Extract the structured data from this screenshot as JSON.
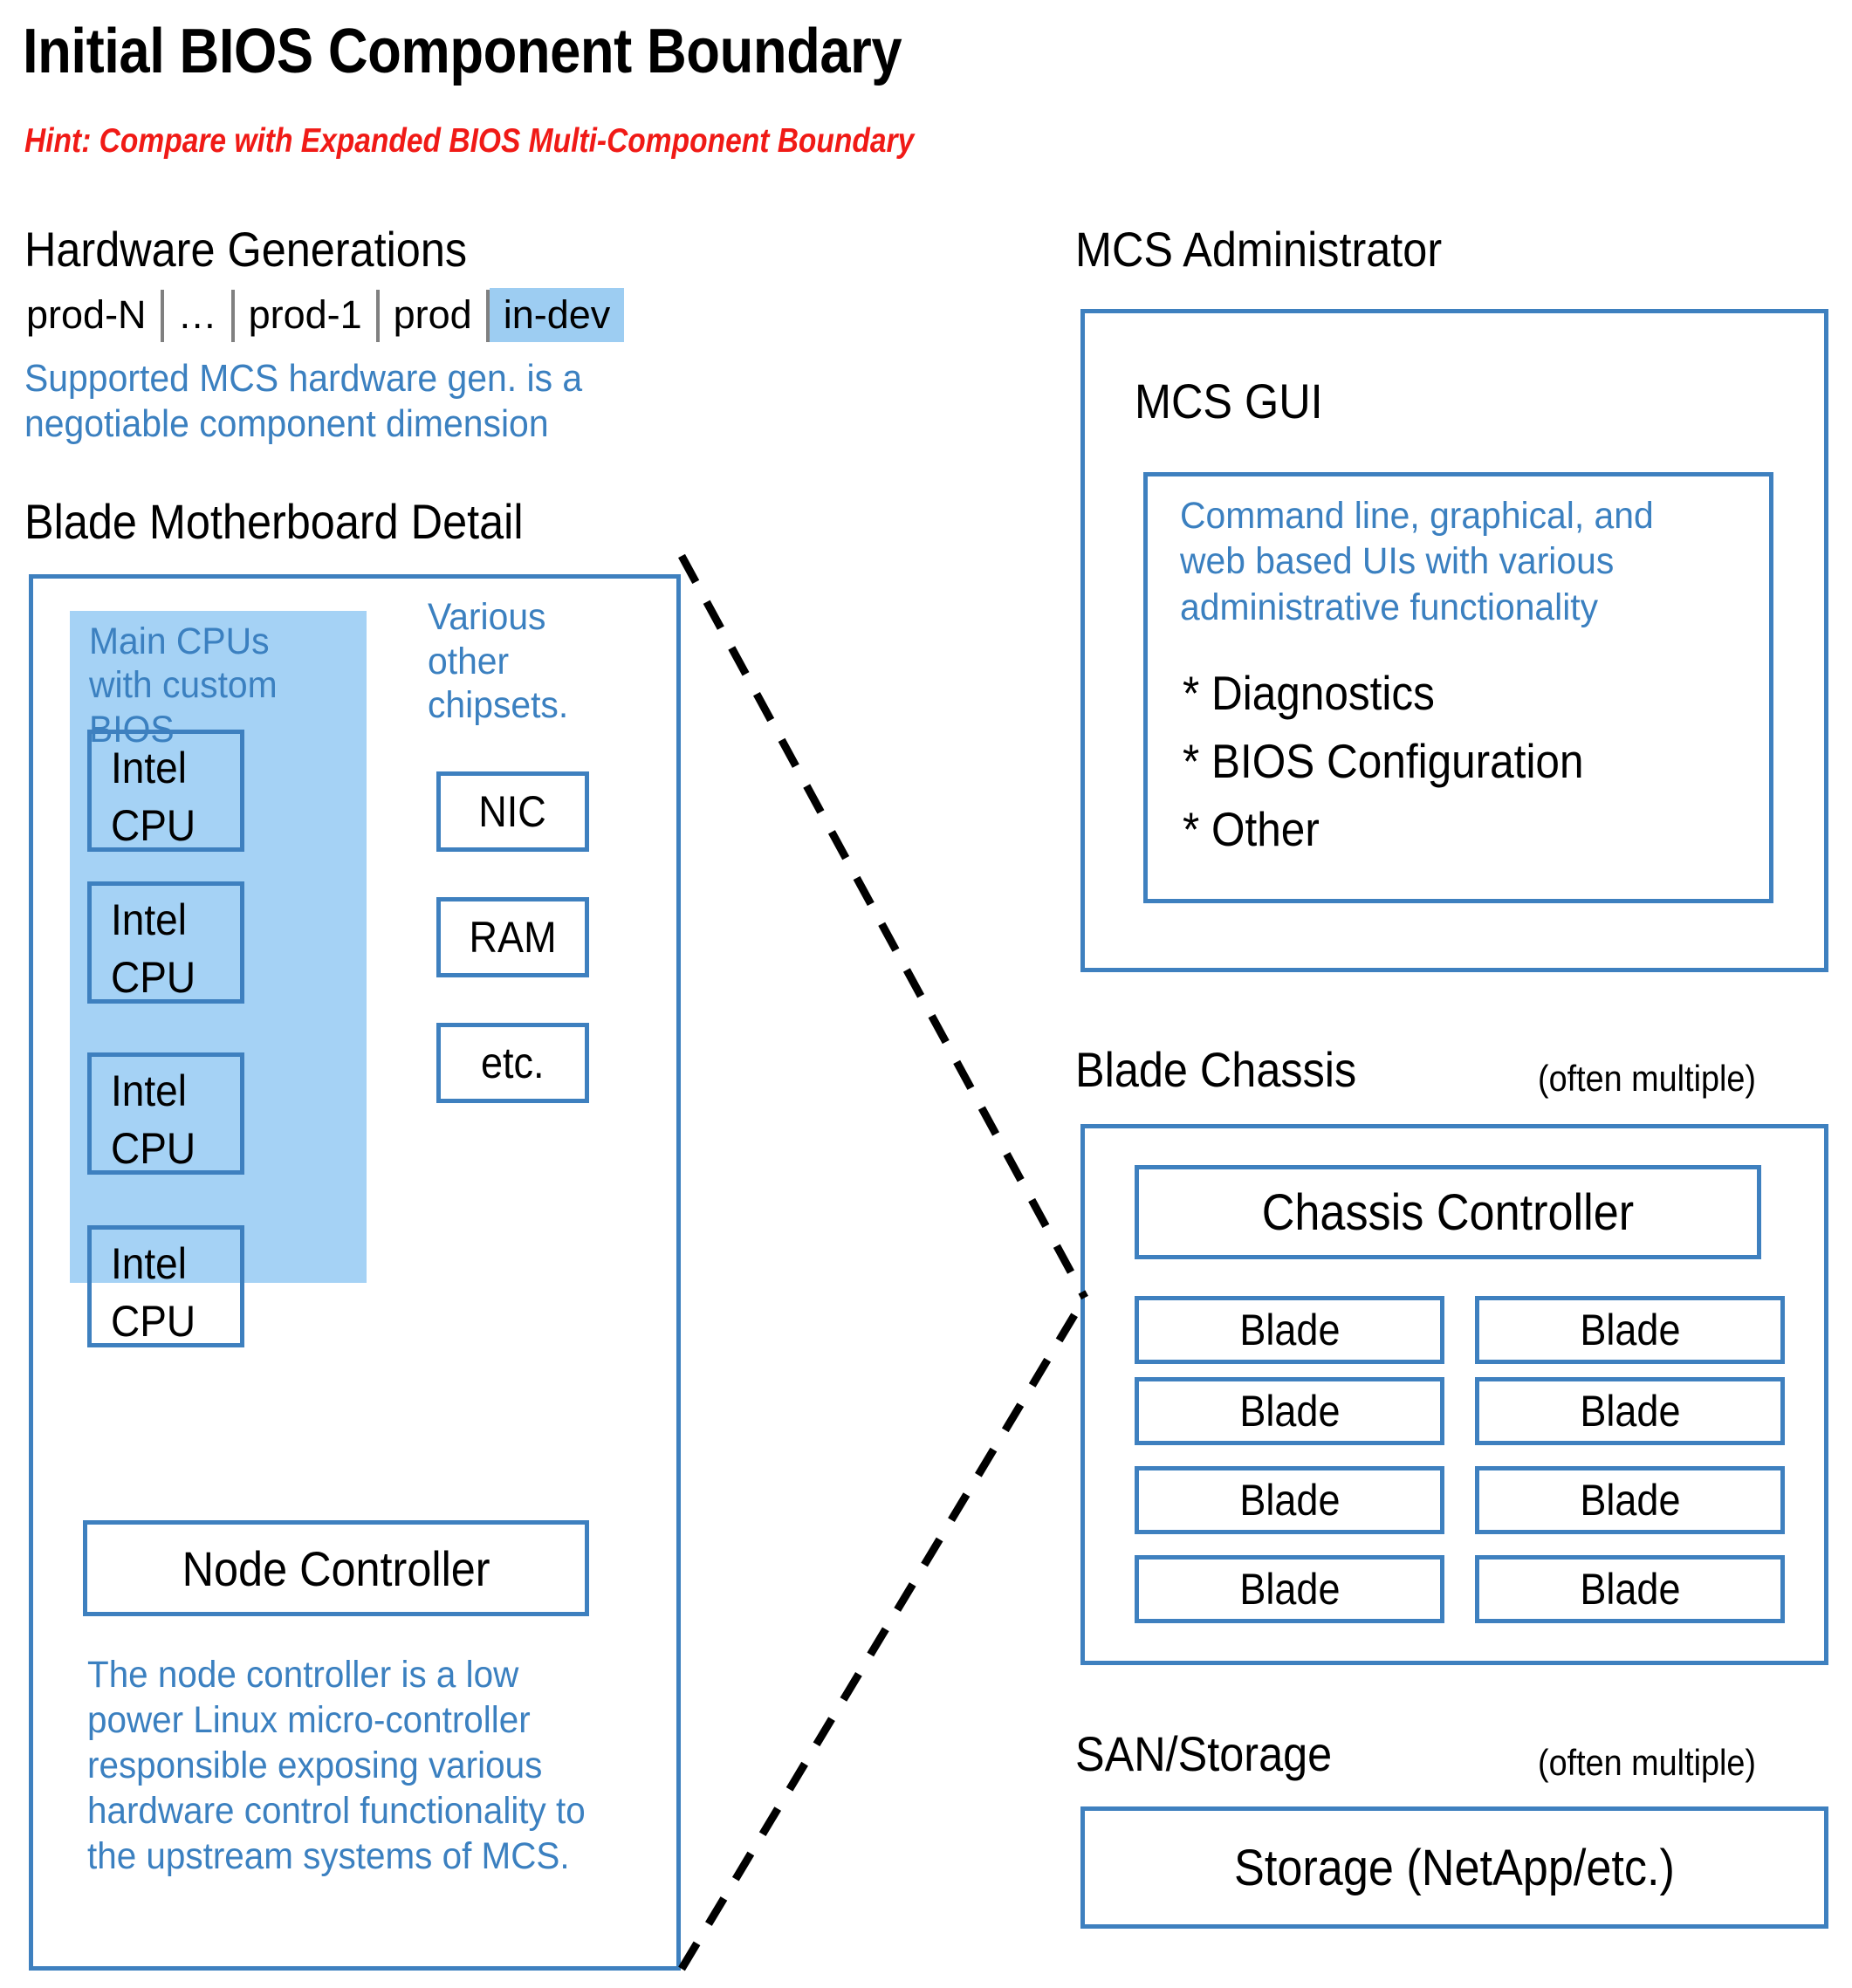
{
  "title": "Initial BIOS Component Boundary",
  "subtitle": "Hint: Compare with  Expanded BIOS Multi-Component Boundary",
  "colors": {
    "accent_blue": "#3E80BF",
    "text_blue": "#3B80C0",
    "panel_fill": "#A5D2F5",
    "highlight_fill": "#9DCDF2",
    "hint_red": "#F01A16",
    "separator_gray": "#808080"
  },
  "hardware_generations": {
    "heading": "Hardware Generations",
    "items": [
      {
        "label": "prod-N",
        "highlighted": false
      },
      {
        "label": "…",
        "highlighted": false
      },
      {
        "label": "prod-1",
        "highlighted": false
      },
      {
        "label": "prod",
        "highlighted": false
      },
      {
        "label": "in-dev",
        "highlighted": true
      }
    ],
    "note": "Supported MCS hardware gen. is a negotiable component dimension"
  },
  "blade_motherboard": {
    "heading": "Blade Motherboard Detail",
    "cpu_panel": {
      "label": "Main CPUs with custom BIOS",
      "cpus": [
        {
          "brand": "Intel",
          "kind": "CPU"
        },
        {
          "brand": "Intel",
          "kind": "CPU"
        },
        {
          "brand": "Intel",
          "kind": "CPU"
        },
        {
          "brand": "Intel",
          "kind": "CPU"
        }
      ]
    },
    "chipsets": {
      "label": "Various other chipsets.",
      "items": [
        "NIC",
        "RAM",
        "etc."
      ]
    },
    "node_controller": {
      "label": "Node Controller",
      "note": "The node controller is a low power Linux  micro-controller responsible exposing various hardware control functionality to the upstream systems of MCS."
    }
  },
  "mcs_administrator": {
    "heading": "MCS Administrator",
    "gui": {
      "heading": "MCS GUI",
      "note": "Command line, graphical, and web based UIs with various administrative functionality",
      "bullets": [
        "* Diagnostics",
        "* BIOS Configuration",
        "* Other"
      ]
    }
  },
  "blade_chassis": {
    "heading": "Blade Chassis",
    "qualifier": "(often multiple)",
    "controller": "Chassis Controller",
    "blades": [
      "Blade",
      "Blade",
      "Blade",
      "Blade",
      "Blade",
      "Blade",
      "Blade",
      "Blade"
    ]
  },
  "san_storage": {
    "heading": "SAN/Storage",
    "qualifier": "(often multiple)",
    "storage": "Storage (NetApp/etc.)"
  }
}
